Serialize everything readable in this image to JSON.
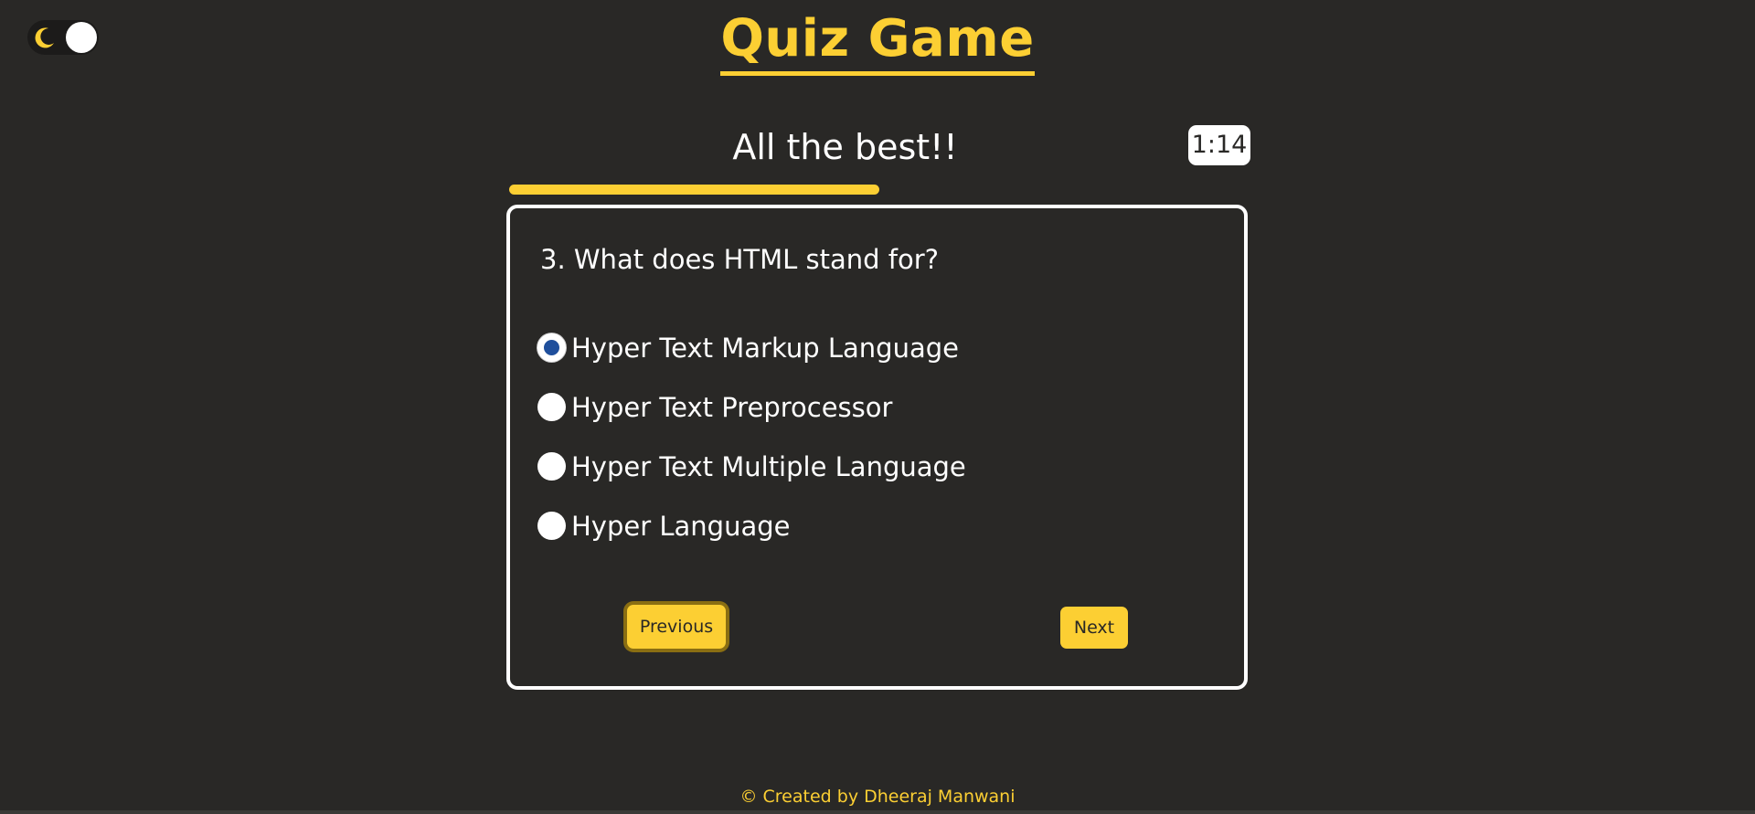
{
  "header": {
    "title": "Quiz Game"
  },
  "theme_toggle": {
    "icon": "moon-icon",
    "mode": "dark"
  },
  "quiz": {
    "subtitle": "All the best!!",
    "timer": "1:14",
    "progress_fraction": 0.5,
    "question": "3. What does HTML stand for?",
    "options": [
      {
        "label": "Hyper Text Markup Language",
        "selected": true
      },
      {
        "label": "Hyper Text Preprocessor",
        "selected": false
      },
      {
        "label": "Hyper Text Multiple Language",
        "selected": false
      },
      {
        "label": "Hyper Language",
        "selected": false
      }
    ],
    "previous_label": "Previous",
    "next_label": "Next"
  },
  "footer": {
    "credit": "© Created by Dheeraj Manwani"
  },
  "colors": {
    "background": "#292826",
    "accent": "#fccf33",
    "selected_radio": "#1f4f9c"
  }
}
